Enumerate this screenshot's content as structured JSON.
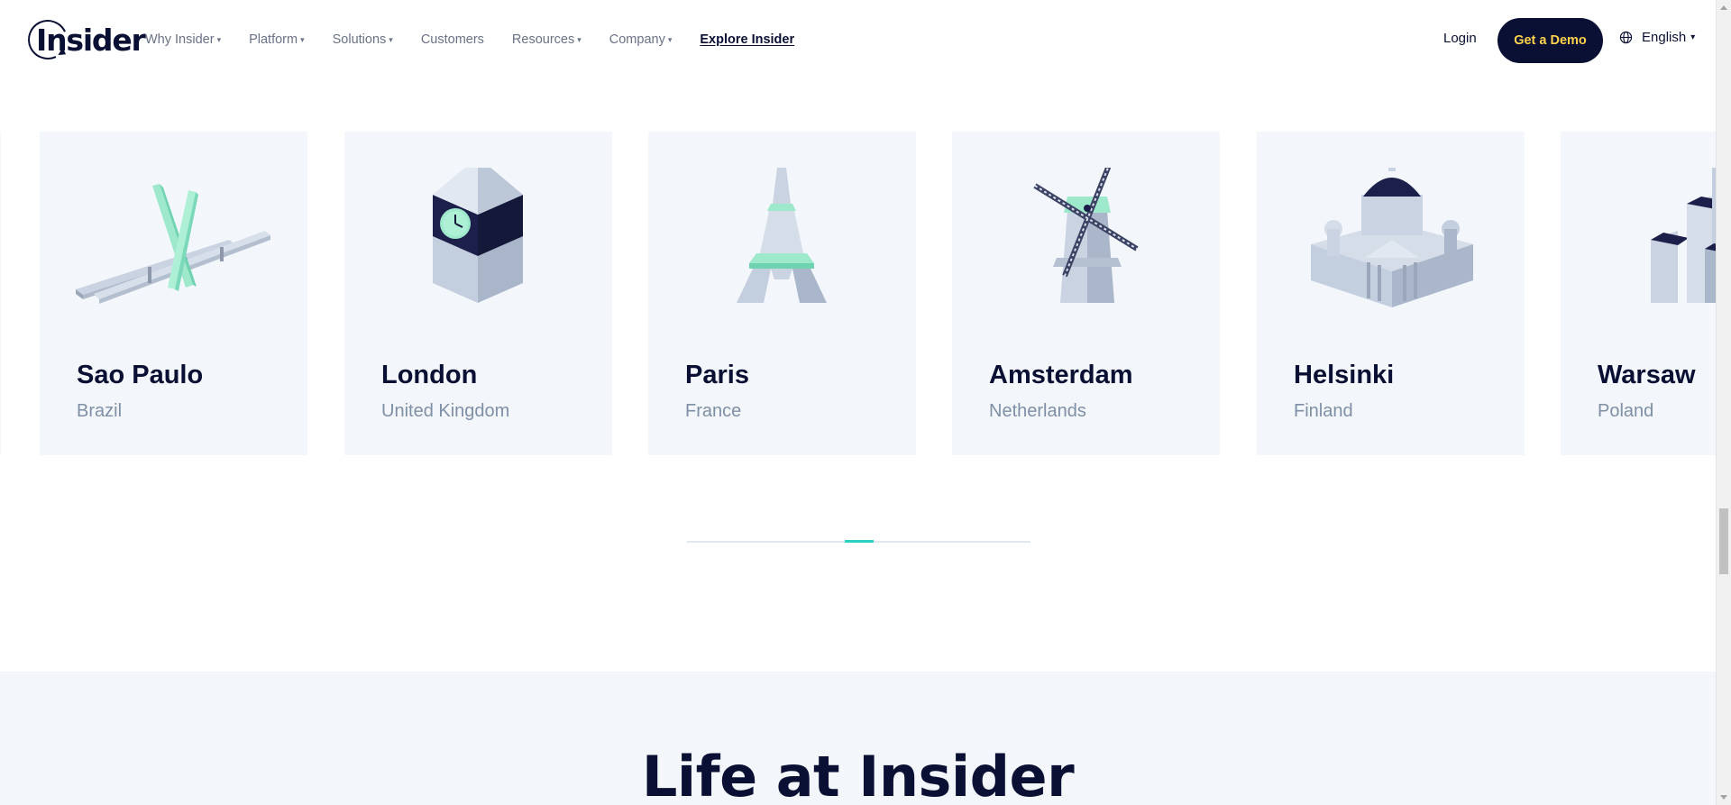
{
  "header": {
    "logo_text": "Insider",
    "nav": [
      {
        "label": "Why Insider",
        "has_dropdown": true
      },
      {
        "label": "Platform",
        "has_dropdown": true
      },
      {
        "label": "Solutions",
        "has_dropdown": true
      },
      {
        "label": "Customers",
        "has_dropdown": false
      },
      {
        "label": "Resources",
        "has_dropdown": true
      },
      {
        "label": "Company",
        "has_dropdown": true
      }
    ],
    "explore_label": "Explore Insider",
    "login_label": "Login",
    "demo_label": "Get a Demo",
    "language_label": "English",
    "caret": "▾"
  },
  "cities": [
    {
      "city": "Sao Paulo",
      "country": "Brazil",
      "landmark": "bridge-icon"
    },
    {
      "city": "London",
      "country": "United Kingdom",
      "landmark": "clock-tower-icon"
    },
    {
      "city": "Paris",
      "country": "France",
      "landmark": "eiffel-tower-icon"
    },
    {
      "city": "Amsterdam",
      "country": "Netherlands",
      "landmark": "windmill-icon"
    },
    {
      "city": "Helsinki",
      "country": "Finland",
      "landmark": "cathedral-icon"
    },
    {
      "city": "Warsaw",
      "country": "Poland",
      "landmark": "palace-tower-icon"
    }
  ],
  "carousel": {
    "progress_fraction": 0.5
  },
  "life_section": {
    "title": "Life at Insider"
  },
  "colors": {
    "navy": "#0a1033",
    "demo_text": "#ffd24d",
    "card_bg": "#f3f6fa",
    "mint": "#9ee8cc",
    "accent_teal": "#2bd1c2",
    "country_gray": "#7e8fa6"
  }
}
